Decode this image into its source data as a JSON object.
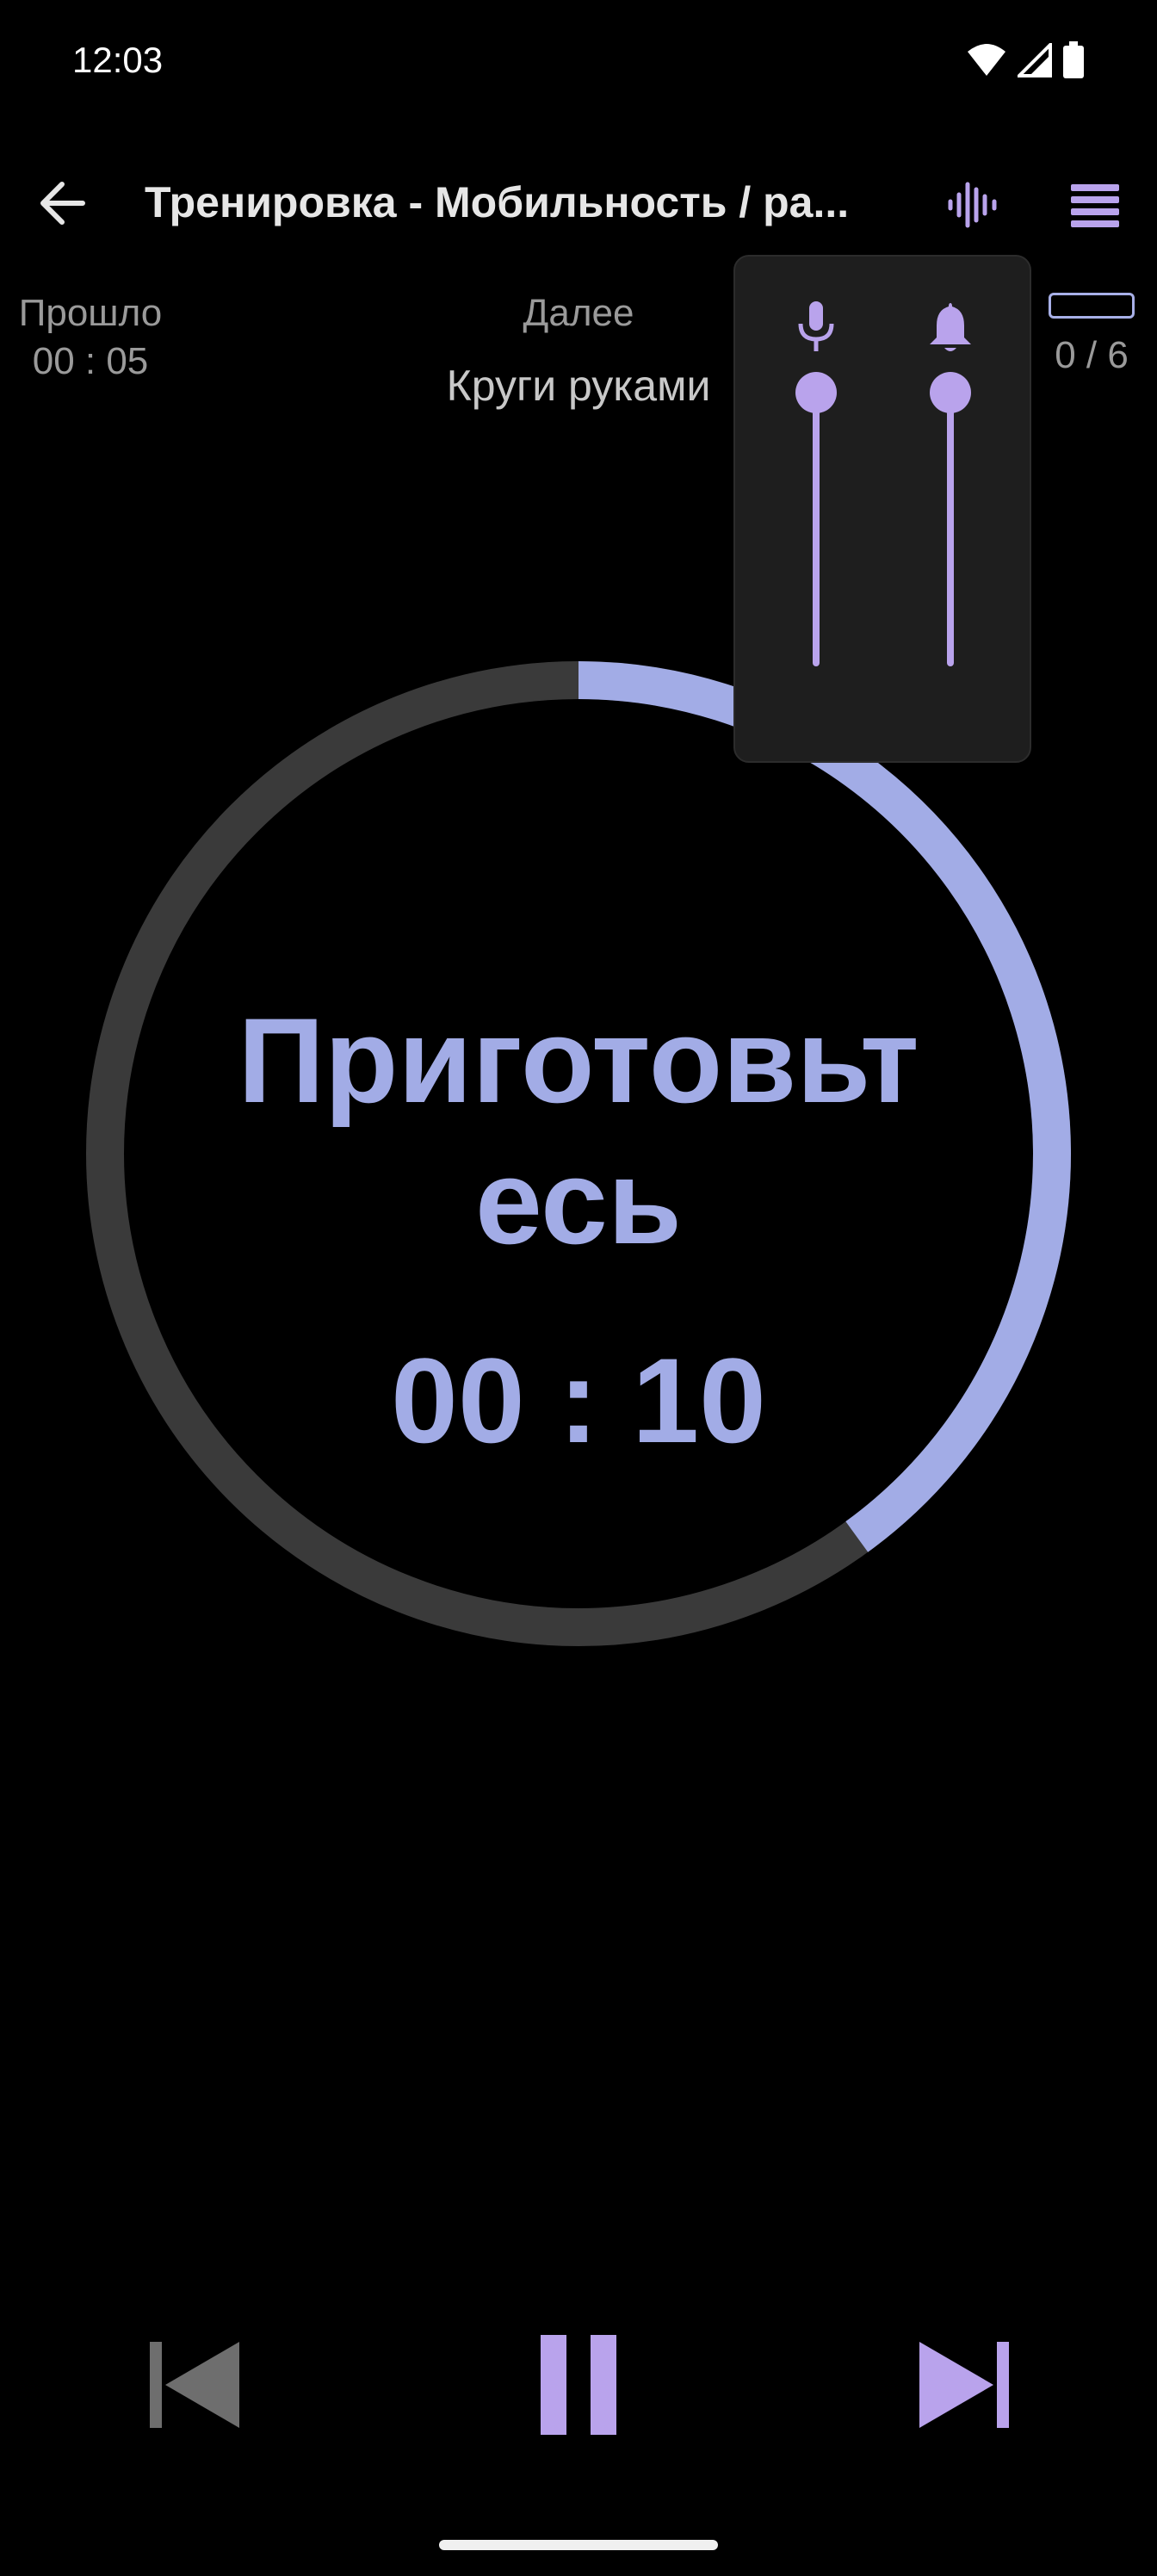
{
  "status": {
    "time": "12:03",
    "icons": [
      "wifi-icon",
      "cell-signal-icon",
      "battery-icon"
    ]
  },
  "appbar": {
    "title": "Тренировка - Мобильность / ра...",
    "back_icon": "arrow-left-icon",
    "voice_icon": "audio-waveform-icon",
    "menu_icon": "list-icon"
  },
  "info": {
    "elapsed_label": "Прошло",
    "elapsed_value": "00 : 05",
    "next_label": "Далее",
    "next_value": "Круги руками",
    "progress_count": "0 / 6"
  },
  "ring": {
    "phase_label": "Приготовьтесь",
    "timer": "00 : 10",
    "progress_fraction": 0.4,
    "progress_color": "#a2ace6",
    "track_color": "#3a3a3a"
  },
  "volume_panel": {
    "voice_icon": "microphone-icon",
    "bell_icon": "bell-icon",
    "voice_level": 1.0,
    "bell_level": 1.0,
    "accent": "#b9a3ec"
  },
  "controls": {
    "prev_icon": "skip-previous-icon",
    "pause_icon": "pause-icon",
    "next_icon": "skip-next-icon",
    "disabled_color": "#6e6e6e",
    "accent": "#b9a3ec"
  }
}
